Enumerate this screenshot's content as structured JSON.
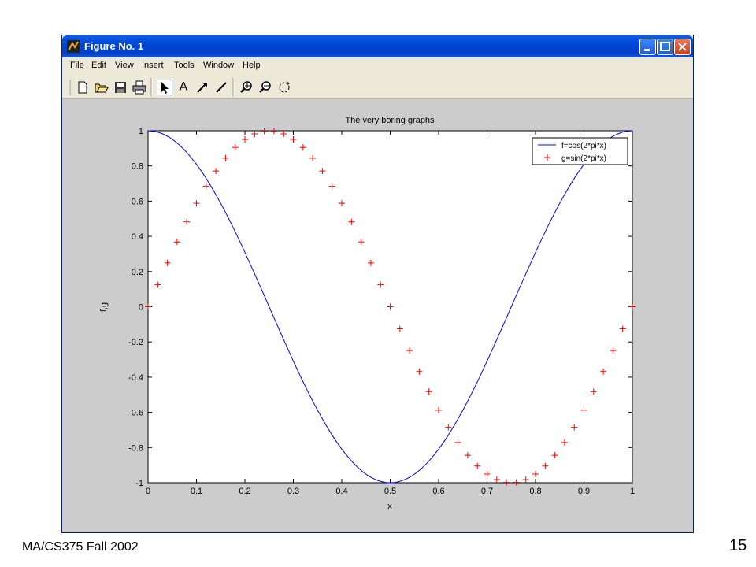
{
  "window": {
    "title": "Figure No. 1",
    "icon": "matlab-figure-icon"
  },
  "menubar": {
    "items": [
      "File",
      "Edit",
      "View",
      "Insert",
      "Tools",
      "Window",
      "Help"
    ]
  },
  "toolbar": {
    "tools": [
      "new-figure-icon",
      "open-file-icon",
      "save-icon",
      "print-icon",
      "edit-plot-arrow-icon",
      "insert-text-icon",
      "insert-arrow-icon",
      "insert-line-icon",
      "zoom-in-icon",
      "zoom-out-icon",
      "rotate-3d-icon"
    ],
    "pressed": "edit-plot-arrow-icon",
    "text_tool_label": "A"
  },
  "chart_data": {
    "type": "line",
    "title": "The very boring graphs",
    "xlabel": "x",
    "ylabel": "f,g",
    "xlim": [
      0,
      1
    ],
    "ylim": [
      -1,
      1
    ],
    "xticks": [
      "0",
      "0.1",
      "0.2",
      "0.3",
      "0.4",
      "0.5",
      "0.6",
      "0.7",
      "0.8",
      "0.9",
      "1"
    ],
    "yticks": [
      "1",
      "0.8",
      "0.6",
      "0.4",
      "0.2",
      "0",
      "-0.2",
      "-0.4",
      "-0.6",
      "-0.8",
      "-1"
    ],
    "grid": false,
    "legend_position": "top-right",
    "series": [
      {
        "name": "f=cos(2*pi*x)",
        "style": "line",
        "color": "#0000ff",
        "x": [
          0,
          0.02,
          0.04,
          0.06,
          0.08,
          0.1,
          0.12,
          0.14,
          0.16,
          0.18,
          0.2,
          0.22,
          0.24,
          0.26,
          0.28,
          0.3,
          0.32,
          0.34,
          0.36,
          0.38,
          0.4,
          0.42,
          0.44,
          0.46,
          0.48,
          0.5,
          0.52,
          0.54,
          0.56,
          0.58,
          0.6,
          0.62,
          0.64,
          0.66,
          0.68,
          0.7,
          0.72,
          0.74,
          0.76,
          0.78,
          0.8,
          0.82,
          0.84,
          0.86,
          0.88,
          0.9,
          0.92,
          0.94,
          0.96,
          0.98,
          1
        ],
        "y": [
          1,
          0.992,
          0.969,
          0.93,
          0.876,
          0.809,
          0.729,
          0.637,
          0.536,
          0.426,
          0.309,
          0.187,
          0.063,
          -0.063,
          -0.187,
          -0.309,
          -0.426,
          -0.536,
          -0.637,
          -0.729,
          -0.809,
          -0.876,
          -0.93,
          -0.969,
          -0.992,
          -1,
          -0.992,
          -0.969,
          -0.93,
          -0.876,
          -0.809,
          -0.729,
          -0.637,
          -0.536,
          -0.426,
          -0.309,
          -0.187,
          -0.063,
          0.063,
          0.187,
          0.309,
          0.426,
          0.536,
          0.637,
          0.729,
          0.809,
          0.876,
          0.93,
          0.969,
          0.992,
          1
        ]
      },
      {
        "name": "g=sin(2*pi*x)",
        "style": "plus-markers",
        "color": "#ff0000",
        "x": [
          0,
          0.02,
          0.04,
          0.06,
          0.08,
          0.1,
          0.12,
          0.14,
          0.16,
          0.18,
          0.2,
          0.22,
          0.24,
          0.26,
          0.28,
          0.3,
          0.32,
          0.34,
          0.36,
          0.38,
          0.4,
          0.42,
          0.44,
          0.46,
          0.48,
          0.5,
          0.52,
          0.54,
          0.56,
          0.58,
          0.6,
          0.62,
          0.64,
          0.66,
          0.68,
          0.7,
          0.72,
          0.74,
          0.76,
          0.78,
          0.8,
          0.82,
          0.84,
          0.86,
          0.88,
          0.9,
          0.92,
          0.94,
          0.96,
          0.98,
          1
        ],
        "y": [
          0,
          0.125,
          0.249,
          0.368,
          0.482,
          0.588,
          0.685,
          0.771,
          0.844,
          0.905,
          0.951,
          0.982,
          0.998,
          0.998,
          0.982,
          0.951,
          0.905,
          0.844,
          0.771,
          0.685,
          0.588,
          0.482,
          0.368,
          0.249,
          0.125,
          0,
          -0.125,
          -0.249,
          -0.368,
          -0.482,
          -0.588,
          -0.685,
          -0.771,
          -0.844,
          -0.905,
          -0.951,
          -0.982,
          -0.998,
          -0.998,
          -0.982,
          -0.951,
          -0.905,
          -0.844,
          -0.771,
          -0.685,
          -0.588,
          -0.482,
          -0.368,
          -0.249,
          -0.125,
          0
        ]
      }
    ]
  },
  "footer": {
    "course": "MA/CS375 Fall 2002",
    "page_number": "15"
  }
}
